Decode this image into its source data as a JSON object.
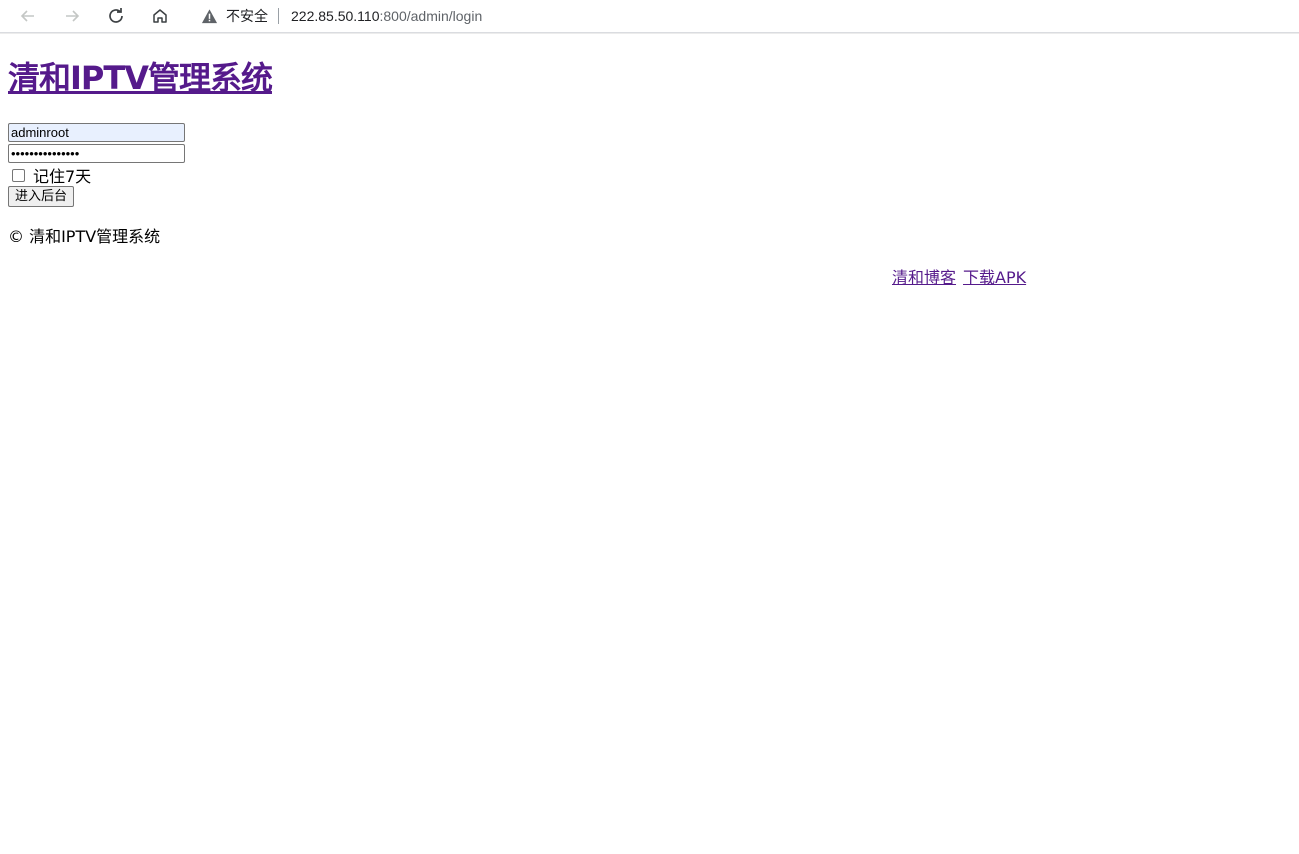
{
  "browser": {
    "insecure_label": "不安全",
    "url_host": "222.85.50.110",
    "url_path": ":800/admin/login"
  },
  "page": {
    "title": "清和IPTV管理系统",
    "form": {
      "username_value": "adminroot",
      "password_mask": "•••••••••••••••",
      "remember_label": "记住7天",
      "submit_label": "进入后台"
    },
    "footer": {
      "copyright": "©  清和IPTV管理系统",
      "links": [
        "清和博客",
        "下载APK"
      ]
    }
  }
}
